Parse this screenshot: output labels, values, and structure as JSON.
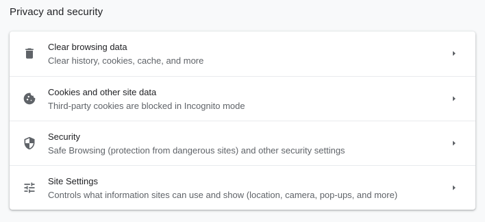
{
  "section": {
    "title": "Privacy and security"
  },
  "items": [
    {
      "icon": "trash-icon",
      "title": "Clear browsing data",
      "subtitle": "Clear history, cookies, cache, and more"
    },
    {
      "icon": "cookie-icon",
      "title": "Cookies and other site data",
      "subtitle": "Third-party cookies are blocked in Incognito mode"
    },
    {
      "icon": "shield-icon",
      "title": "Security",
      "subtitle": "Safe Browsing (protection from dangerous sites) and other security settings"
    },
    {
      "icon": "tune-icon",
      "title": "Site Settings",
      "subtitle": "Controls what information sites can use and show (location, camera, pop-ups, and more)"
    }
  ],
  "colors": {
    "icon": "#5f6368",
    "title": "#202124",
    "subtitle": "#5f6368",
    "divider": "#e8eaed"
  }
}
